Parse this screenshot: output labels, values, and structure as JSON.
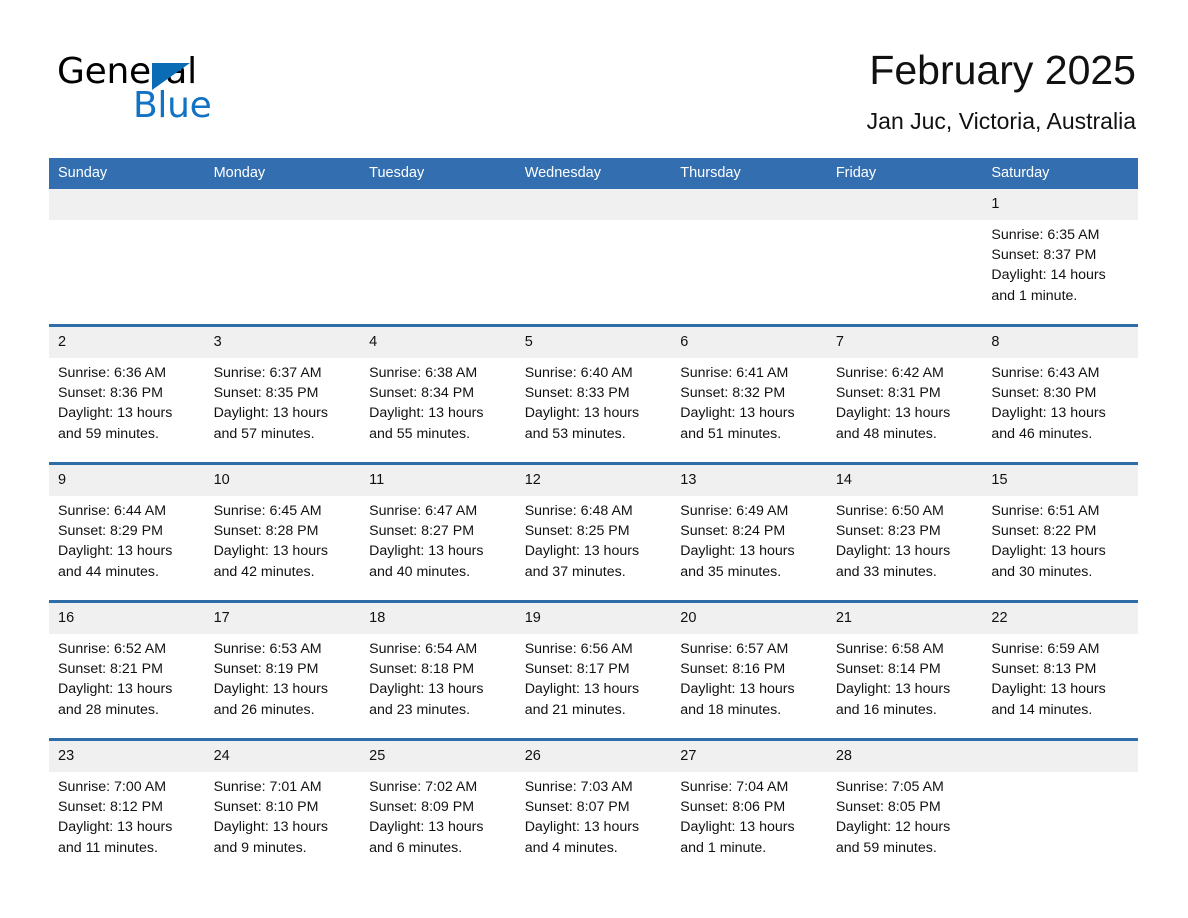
{
  "brand": {
    "logo_text_primary": "General",
    "logo_text_secondary": "Blue",
    "logo_triangle_color": "#0a6cb4",
    "logo_secondary_color": "#1273c4"
  },
  "header": {
    "title": "February 2025",
    "subtitle": "Jan Juc, Victoria, Australia"
  },
  "theme": {
    "header_bg": "#336fb0",
    "row_divider": "#2e6da8",
    "daynum_bg": "#f0f0f0",
    "text": "#111111"
  },
  "calendar": {
    "weekday_headers": [
      "Sunday",
      "Monday",
      "Tuesday",
      "Wednesday",
      "Thursday",
      "Friday",
      "Saturday"
    ],
    "weeks": [
      [
        {
          "day": "",
          "sunrise": "",
          "sunset": "",
          "daylight": ""
        },
        {
          "day": "",
          "sunrise": "",
          "sunset": "",
          "daylight": ""
        },
        {
          "day": "",
          "sunrise": "",
          "sunset": "",
          "daylight": ""
        },
        {
          "day": "",
          "sunrise": "",
          "sunset": "",
          "daylight": ""
        },
        {
          "day": "",
          "sunrise": "",
          "sunset": "",
          "daylight": ""
        },
        {
          "day": "",
          "sunrise": "",
          "sunset": "",
          "daylight": ""
        },
        {
          "day": "1",
          "sunrise": "Sunrise: 6:35 AM",
          "sunset": "Sunset: 8:37 PM",
          "daylight": "Daylight: 14 hours and 1 minute."
        }
      ],
      [
        {
          "day": "2",
          "sunrise": "Sunrise: 6:36 AM",
          "sunset": "Sunset: 8:36 PM",
          "daylight": "Daylight: 13 hours and 59 minutes."
        },
        {
          "day": "3",
          "sunrise": "Sunrise: 6:37 AM",
          "sunset": "Sunset: 8:35 PM",
          "daylight": "Daylight: 13 hours and 57 minutes."
        },
        {
          "day": "4",
          "sunrise": "Sunrise: 6:38 AM",
          "sunset": "Sunset: 8:34 PM",
          "daylight": "Daylight: 13 hours and 55 minutes."
        },
        {
          "day": "5",
          "sunrise": "Sunrise: 6:40 AM",
          "sunset": "Sunset: 8:33 PM",
          "daylight": "Daylight: 13 hours and 53 minutes."
        },
        {
          "day": "6",
          "sunrise": "Sunrise: 6:41 AM",
          "sunset": "Sunset: 8:32 PM",
          "daylight": "Daylight: 13 hours and 51 minutes."
        },
        {
          "day": "7",
          "sunrise": "Sunrise: 6:42 AM",
          "sunset": "Sunset: 8:31 PM",
          "daylight": "Daylight: 13 hours and 48 minutes."
        },
        {
          "day": "8",
          "sunrise": "Sunrise: 6:43 AM",
          "sunset": "Sunset: 8:30 PM",
          "daylight": "Daylight: 13 hours and 46 minutes."
        }
      ],
      [
        {
          "day": "9",
          "sunrise": "Sunrise: 6:44 AM",
          "sunset": "Sunset: 8:29 PM",
          "daylight": "Daylight: 13 hours and 44 minutes."
        },
        {
          "day": "10",
          "sunrise": "Sunrise: 6:45 AM",
          "sunset": "Sunset: 8:28 PM",
          "daylight": "Daylight: 13 hours and 42 minutes."
        },
        {
          "day": "11",
          "sunrise": "Sunrise: 6:47 AM",
          "sunset": "Sunset: 8:27 PM",
          "daylight": "Daylight: 13 hours and 40 minutes."
        },
        {
          "day": "12",
          "sunrise": "Sunrise: 6:48 AM",
          "sunset": "Sunset: 8:25 PM",
          "daylight": "Daylight: 13 hours and 37 minutes."
        },
        {
          "day": "13",
          "sunrise": "Sunrise: 6:49 AM",
          "sunset": "Sunset: 8:24 PM",
          "daylight": "Daylight: 13 hours and 35 minutes."
        },
        {
          "day": "14",
          "sunrise": "Sunrise: 6:50 AM",
          "sunset": "Sunset: 8:23 PM",
          "daylight": "Daylight: 13 hours and 33 minutes."
        },
        {
          "day": "15",
          "sunrise": "Sunrise: 6:51 AM",
          "sunset": "Sunset: 8:22 PM",
          "daylight": "Daylight: 13 hours and 30 minutes."
        }
      ],
      [
        {
          "day": "16",
          "sunrise": "Sunrise: 6:52 AM",
          "sunset": "Sunset: 8:21 PM",
          "daylight": "Daylight: 13 hours and 28 minutes."
        },
        {
          "day": "17",
          "sunrise": "Sunrise: 6:53 AM",
          "sunset": "Sunset: 8:19 PM",
          "daylight": "Daylight: 13 hours and 26 minutes."
        },
        {
          "day": "18",
          "sunrise": "Sunrise: 6:54 AM",
          "sunset": "Sunset: 8:18 PM",
          "daylight": "Daylight: 13 hours and 23 minutes."
        },
        {
          "day": "19",
          "sunrise": "Sunrise: 6:56 AM",
          "sunset": "Sunset: 8:17 PM",
          "daylight": "Daylight: 13 hours and 21 minutes."
        },
        {
          "day": "20",
          "sunrise": "Sunrise: 6:57 AM",
          "sunset": "Sunset: 8:16 PM",
          "daylight": "Daylight: 13 hours and 18 minutes."
        },
        {
          "day": "21",
          "sunrise": "Sunrise: 6:58 AM",
          "sunset": "Sunset: 8:14 PM",
          "daylight": "Daylight: 13 hours and 16 minutes."
        },
        {
          "day": "22",
          "sunrise": "Sunrise: 6:59 AM",
          "sunset": "Sunset: 8:13 PM",
          "daylight": "Daylight: 13 hours and 14 minutes."
        }
      ],
      [
        {
          "day": "23",
          "sunrise": "Sunrise: 7:00 AM",
          "sunset": "Sunset: 8:12 PM",
          "daylight": "Daylight: 13 hours and 11 minutes."
        },
        {
          "day": "24",
          "sunrise": "Sunrise: 7:01 AM",
          "sunset": "Sunset: 8:10 PM",
          "daylight": "Daylight: 13 hours and 9 minutes."
        },
        {
          "day": "25",
          "sunrise": "Sunrise: 7:02 AM",
          "sunset": "Sunset: 8:09 PM",
          "daylight": "Daylight: 13 hours and 6 minutes."
        },
        {
          "day": "26",
          "sunrise": "Sunrise: 7:03 AM",
          "sunset": "Sunset: 8:07 PM",
          "daylight": "Daylight: 13 hours and 4 minutes."
        },
        {
          "day": "27",
          "sunrise": "Sunrise: 7:04 AM",
          "sunset": "Sunset: 8:06 PM",
          "daylight": "Daylight: 13 hours and 1 minute."
        },
        {
          "day": "28",
          "sunrise": "Sunrise: 7:05 AM",
          "sunset": "Sunset: 8:05 PM",
          "daylight": "Daylight: 12 hours and 59 minutes."
        },
        {
          "day": "",
          "sunrise": "",
          "sunset": "",
          "daylight": ""
        }
      ]
    ]
  }
}
